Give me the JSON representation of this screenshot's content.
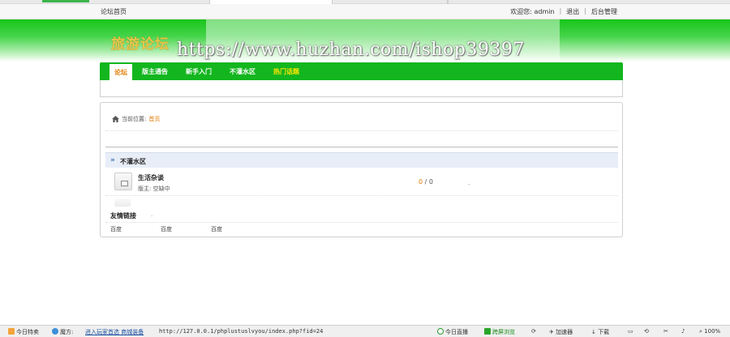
{
  "topbar": {
    "home_link": "论坛首页",
    "welcome": "欢迎您: admin",
    "logout": "退出",
    "admin": "后台管理"
  },
  "header": {
    "site_title": "旅游论坛",
    "watermark": "https://www.huzhan.com/ishop39397"
  },
  "nav": {
    "items": [
      "论坛",
      "版主通告",
      "新手入门",
      "不灌水区",
      "热门话题"
    ],
    "active_index": 0
  },
  "breadcrumb": {
    "label": "当前位置:",
    "current": "首页"
  },
  "forum_section": {
    "title": "不灌水区",
    "forums": [
      {
        "name": "生活杂谈",
        "moderator": "版主: 空缺中",
        "topics": "0",
        "posts": "0",
        "last": "-"
      }
    ]
  },
  "friend_links": {
    "title": "友情链接",
    "dot": ".",
    "items": [
      "百度",
      "百度",
      "百度"
    ]
  },
  "statusbar": {
    "today_deals": "今日特卖",
    "weather_label": "魔方:",
    "promo_link": "进入玩家首选 商城装备",
    "url": "http://127.0.0.1/phplustuslvyou/index.php?fid=24",
    "live": "今日直播",
    "fullscreen": "跨屏浏览",
    "accelerator": "加速器",
    "download": "下载",
    "zoom": "100%"
  },
  "colors": {
    "nav_green": "#13b61f",
    "accent_orange": "#e07b00",
    "hot_yellow": "#ffe600"
  }
}
